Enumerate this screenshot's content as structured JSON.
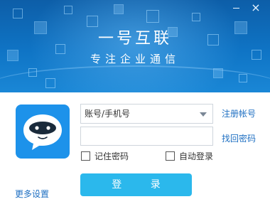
{
  "window": {
    "title": "一号互联",
    "subtitle": "专注企业通信",
    "minimize_icon": "minimize-icon",
    "close_label": "×",
    "accent_color": "#0f74c5"
  },
  "login_form": {
    "account_placeholder": "账号/手机号",
    "password_value": "",
    "register_link": "注册帐号",
    "find_password_link": "找回密码",
    "remember_password_label": "记住密码",
    "auto_login_label": "自动登录",
    "remember_password_checked": false,
    "auto_login_checked": false,
    "login_button": "登 录",
    "more_settings_link": "更多设置",
    "button_color": "#2bb8ec"
  }
}
